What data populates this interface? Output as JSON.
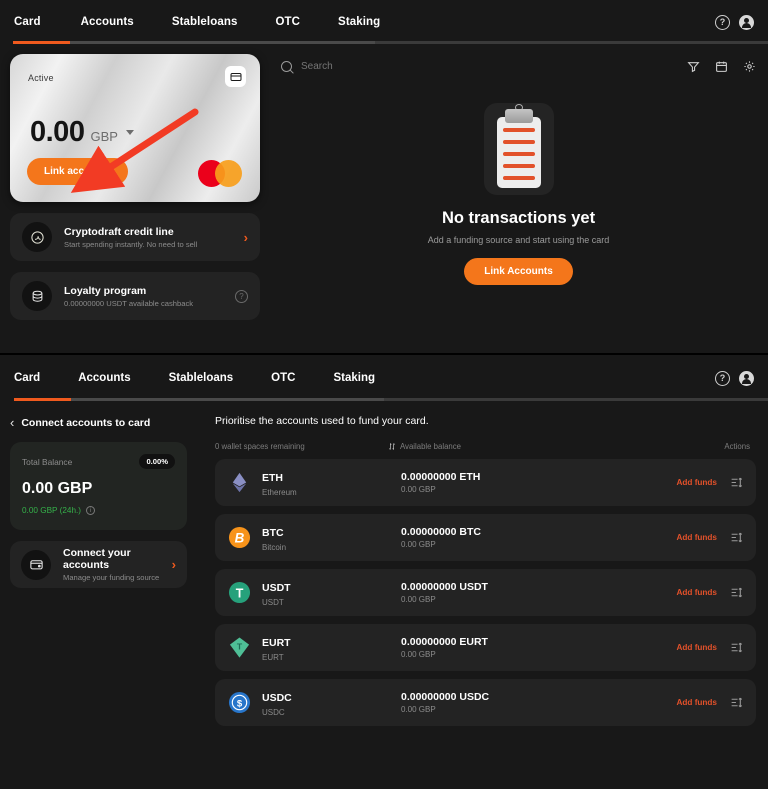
{
  "top": {
    "tabs": [
      {
        "label": "Card",
        "active": true
      },
      {
        "label": "Accounts",
        "active": false
      },
      {
        "label": "Stableloans",
        "active": false
      },
      {
        "label": "OTC",
        "active": false
      },
      {
        "label": "Staking",
        "active": false
      }
    ],
    "help_icon": "question-mark-icon",
    "avatar_icon": "user-avatar-icon",
    "card": {
      "status": "Active",
      "amount": "0.00",
      "currency": "GBP",
      "cta": "Link accounts",
      "chip_icon": "card-icon",
      "brand_icon": "mastercard-logo",
      "annotation_icon": "red-arrow-annotation"
    },
    "promos": [
      {
        "icon": "cryptodraft-icon",
        "title": "Cryptodraft credit line",
        "subtitle": "Start spending instantly. No need to sell",
        "action_icon": "chevron-right-icon"
      },
      {
        "icon": "coins-stack-icon",
        "title": "Loyalty program",
        "subtitle": "0.00000000 USDT available cashback",
        "action_icon": "question-mark-icon"
      }
    ],
    "search": {
      "placeholder": "Search",
      "icon": "search-icon"
    },
    "tools": [
      {
        "name": "filter-icon",
        "label": "Filter"
      },
      {
        "name": "calendar-icon",
        "label": "Calendar"
      },
      {
        "name": "gear-icon",
        "label": "Settings"
      }
    ],
    "empty": {
      "illustration": "clipboard-icon",
      "heading": "No transactions yet",
      "subtext": "Add a funding source and start using the card",
      "cta": "Link Accounts"
    }
  },
  "bottom": {
    "tabs": [
      {
        "label": "Card",
        "active": true
      },
      {
        "label": "Accounts",
        "active": false
      },
      {
        "label": "Stableloans",
        "active": false
      },
      {
        "label": "OTC",
        "active": false
      },
      {
        "label": "Staking",
        "active": false
      }
    ],
    "back_label": "Connect accounts to card",
    "back_icon": "chevron-left-icon",
    "balance": {
      "label": "Total Balance",
      "percent": "0.00%",
      "amount": "0.00 GBP",
      "change": "0.00 GBP (24h.)",
      "info_icon": "info-icon"
    },
    "connect": {
      "icon": "wallet-icon",
      "title": "Connect your accounts",
      "subtitle": "Manage your funding source",
      "action_icon": "chevron-right-icon"
    },
    "list": {
      "title": "Prioritise the accounts used to fund your card.",
      "col_spaces": "0 wallet spaces remaining",
      "col_balance": "Available balance",
      "col_balance_icon": "sort-icon",
      "col_actions": "Actions",
      "add_funds_label": "Add funds",
      "drag_icon": "reorder-icon",
      "rows": [
        {
          "symbol": "ETH",
          "name": "Ethereum",
          "amount": "0.00000000 ETH",
          "fiat": "0.00 GBP",
          "color": "#7a7fb5",
          "icon": "eth-icon"
        },
        {
          "symbol": "BTC",
          "name": "Bitcoin",
          "amount": "0.00000000 BTC",
          "fiat": "0.00 GBP",
          "color": "#f7931a",
          "icon": "btc-icon"
        },
        {
          "symbol": "USDT",
          "name": "USDT",
          "amount": "0.00000000 USDT",
          "fiat": "0.00 GBP",
          "color": "#26a17b",
          "icon": "usdt-icon"
        },
        {
          "symbol": "EURT",
          "name": "EURT",
          "amount": "0.00000000 EURT",
          "fiat": "0.00 GBP",
          "color": "#4fbf96",
          "icon": "eurt-icon"
        },
        {
          "symbol": "USDC",
          "name": "USDC",
          "amount": "0.00000000 USDC",
          "fiat": "0.00 GBP",
          "color": "#2775ca",
          "icon": "usdc-icon"
        }
      ]
    }
  },
  "colors": {
    "accent": "#f4761b",
    "accent_dark": "#e2512a",
    "background": "#181818",
    "panel": "#232323",
    "green": "#35b14a"
  }
}
